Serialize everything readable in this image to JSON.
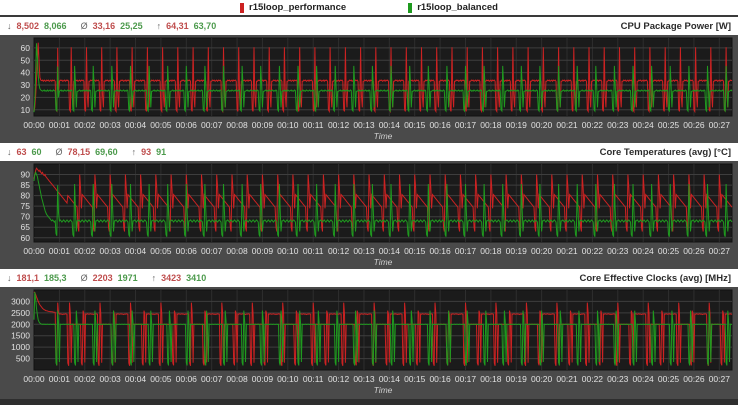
{
  "symbols": {
    "min": "↓",
    "avg": "Ø",
    "max": "↑"
  },
  "legend": {
    "items": [
      {
        "label": "r15loop_performance",
        "color": "#cc2222"
      },
      {
        "label": "r15loop_balanced",
        "color": "#1f9a1f"
      }
    ]
  },
  "time_axis": {
    "label": "Time"
  },
  "chart_data": [
    {
      "type": "line",
      "title": "CPU Package Power [W]",
      "unit": "W",
      "xlabel": "Time",
      "x_ticks": [
        "00:00",
        "00:01",
        "00:02",
        "00:03",
        "00:04",
        "00:05",
        "00:06",
        "00:07",
        "00:08",
        "00:09",
        "00:10",
        "00:11",
        "00:12",
        "00:13",
        "00:14",
        "00:15",
        "00:16",
        "00:17",
        "00:18",
        "00:19",
        "00:20",
        "00:21",
        "00:22",
        "00:23",
        "00:24",
        "00:25",
        "00:26",
        "00:27"
      ],
      "x_tick_interval_s": 60,
      "duration_s": 1650,
      "y_ticks": [
        10,
        20,
        30,
        40,
        50,
        60
      ],
      "y_range": [
        5,
        68
      ],
      "grid": true,
      "legend_position": "top",
      "stats_display": {
        "min_red": "8,502",
        "min_green": "8,066",
        "avg_red": "33,16",
        "avg_green": "25,25",
        "max_red": "64,31",
        "max_green": "63,70"
      },
      "series": [
        {
          "name": "r15loop_performance",
          "color": "#cc2222",
          "min": 8.502,
          "avg": 33.16,
          "max": 64.31,
          "step_s": 2,
          "start": [
            8.5,
            12,
            22,
            35,
            50,
            64.31,
            48,
            36,
            34,
            33.5,
            34,
            33,
            34,
            33.5,
            33,
            34,
            33.5,
            34,
            33,
            33.5,
            34,
            33,
            34,
            33.5,
            34,
            33,
            10,
            9,
            60,
            25
          ],
          "cycle": [
            33,
            34,
            33.5,
            34,
            33,
            33.5,
            34,
            33,
            34,
            33.5,
            34,
            33,
            10,
            8.7,
            60.5,
            22,
            12,
            33
          ]
        },
        {
          "name": "r15loop_balanced",
          "color": "#1f9a1f",
          "min": 8.066,
          "avg": 25.25,
          "max": 63.7,
          "step_s": 2,
          "start": [
            8.1,
            18,
            40,
            63.7,
            52,
            38,
            30,
            27,
            26,
            25.5,
            25,
            25.5,
            26,
            25,
            25.5,
            25,
            26,
            25,
            25.5,
            26,
            25,
            25.5,
            25,
            26,
            25.5,
            25,
            10,
            9.2,
            45,
            20
          ],
          "cycle": [
            25,
            25.5,
            26,
            25,
            25.5,
            25,
            26,
            25.5,
            25,
            25.5,
            26,
            25,
            25.5,
            25,
            26,
            25.5,
            10,
            9,
            45.5,
            30,
            12,
            25
          ]
        }
      ]
    },
    {
      "type": "line",
      "title": "Core Temperatures (avg) [°C]",
      "unit": "°C",
      "xlabel": "Time",
      "x_ticks": [
        "00:00",
        "00:01",
        "00:02",
        "00:03",
        "00:04",
        "00:05",
        "00:06",
        "00:07",
        "00:08",
        "00:09",
        "00:10",
        "00:11",
        "00:12",
        "00:13",
        "00:14",
        "00:15",
        "00:16",
        "00:17",
        "00:18",
        "00:19",
        "00:20",
        "00:21",
        "00:22",
        "00:23",
        "00:24",
        "00:25",
        "00:26",
        "00:27"
      ],
      "x_tick_interval_s": 60,
      "duration_s": 1650,
      "y_ticks": [
        60,
        65,
        70,
        75,
        80,
        85,
        90
      ],
      "y_range": [
        58,
        95
      ],
      "grid": true,
      "legend_position": "top",
      "stats_display": {
        "min_red": "63",
        "min_green": "60",
        "avg_red": "78,15",
        "avg_green": "69,60",
        "max_red": "93",
        "max_green": "91"
      },
      "series": [
        {
          "name": "r15loop_performance",
          "color": "#cc2222",
          "min": 63,
          "avg": 78.15,
          "max": 93,
          "step_s": 2,
          "start": [
            88,
            90,
            92,
            93,
            92.5,
            92,
            91.5,
            92,
            91,
            90.5,
            91,
            90,
            89.5,
            90,
            89,
            88.5,
            88,
            87.5,
            87,
            86.5,
            86,
            85.5,
            85,
            84.5,
            84,
            83.5,
            83,
            82.5,
            82,
            81.5,
            81,
            80.5,
            80,
            79.5,
            79,
            78.5,
            78,
            77.5,
            77,
            76.5
          ],
          "cycle": [
            80,
            79.5,
            79,
            78.5,
            78,
            77.5,
            77,
            76.5,
            76,
            75.5,
            75,
            74.5,
            65,
            63,
            90,
            84,
            74,
            80.5
          ]
        },
        {
          "name": "r15loop_balanced",
          "color": "#1f9a1f",
          "min": 60,
          "avg": 69.6,
          "max": 91,
          "step_s": 2,
          "start": [
            87,
            90,
            91,
            90,
            89,
            87,
            85,
            83,
            81,
            79,
            77.5,
            76,
            74.5,
            73,
            72,
            71,
            70.5,
            70,
            69.5,
            69,
            68.5,
            68,
            68.5,
            68,
            67.5,
            68,
            62,
            61,
            85,
            72
          ],
          "cycle": [
            68,
            68.5,
            68,
            67.5,
            68,
            68.5,
            68,
            67.5,
            68,
            68.5,
            68,
            67.5,
            68,
            68.5,
            68,
            67.5,
            61.5,
            60.5,
            85.5,
            73,
            63,
            68
          ]
        }
      ]
    },
    {
      "type": "line",
      "title": "Core Effective Clocks (avg) [MHz]",
      "unit": "MHz",
      "xlabel": "Time",
      "x_ticks": [
        "00:00",
        "00:01",
        "00:02",
        "00:03",
        "00:04",
        "00:05",
        "00:06",
        "00:07",
        "00:08",
        "00:09",
        "00:10",
        "00:11",
        "00:12",
        "00:13",
        "00:14",
        "00:15",
        "00:16",
        "00:17",
        "00:18",
        "00:19",
        "00:20",
        "00:21",
        "00:22",
        "00:23",
        "00:24",
        "00:25",
        "00:26",
        "00:27"
      ],
      "x_tick_interval_s": 60,
      "duration_s": 1650,
      "y_ticks": [
        500,
        1000,
        1500,
        2000,
        2500,
        3000
      ],
      "y_range": [
        0,
        3500
      ],
      "grid": true,
      "legend_position": "top",
      "stats_display": {
        "min_red": "181,1",
        "min_green": "185,3",
        "avg_red": "2203",
        "avg_green": "1971",
        "max_red": "3423",
        "max_green": "3410"
      },
      "series": [
        {
          "name": "r15loop_performance",
          "color": "#cc2222",
          "min": 181.1,
          "avg": 2203,
          "max": 3423,
          "step_s": 2,
          "start": [
            3423,
            3380,
            3300,
            3200,
            3100,
            3000,
            2920,
            2850,
            2800,
            2750,
            2700,
            2670,
            2640,
            2620,
            2600,
            2590,
            2580,
            2570,
            2560,
            2555,
            2550,
            2545,
            2540,
            2535,
            2530,
            2525,
            350,
            200,
            2950,
            2520
          ],
          "cycle": [
            2450,
            2460,
            2440,
            2450,
            2430,
            2450,
            2440,
            2460,
            2450,
            2440,
            300,
            185,
            2950,
            2450,
            320,
            2000,
            2010,
            1990,
            2000,
            2010,
            2000,
            1990,
            2010,
            2000,
            1990,
            2000,
            310,
            200,
            2600,
            2450,
            330,
            2450,
            2440,
            2460,
            2450,
            2440
          ]
        },
        {
          "name": "r15loop_balanced",
          "color": "#1f9a1f",
          "min": 185.3,
          "avg": 1971,
          "max": 3410,
          "step_s": 2,
          "start": [
            2200,
            3410,
            3100,
            2700,
            2400,
            2200,
            2100,
            2050,
            2020,
            2010,
            2000,
            2010
          ],
          "cycle": [
            2000,
            2010,
            1990,
            2000,
            2010,
            2000,
            1990,
            2010,
            2000,
            1990,
            2000,
            2010,
            1990,
            2000,
            330,
            195,
            2600,
            2100,
            350,
            2010,
            2000,
            1990
          ]
        }
      ]
    }
  ]
}
